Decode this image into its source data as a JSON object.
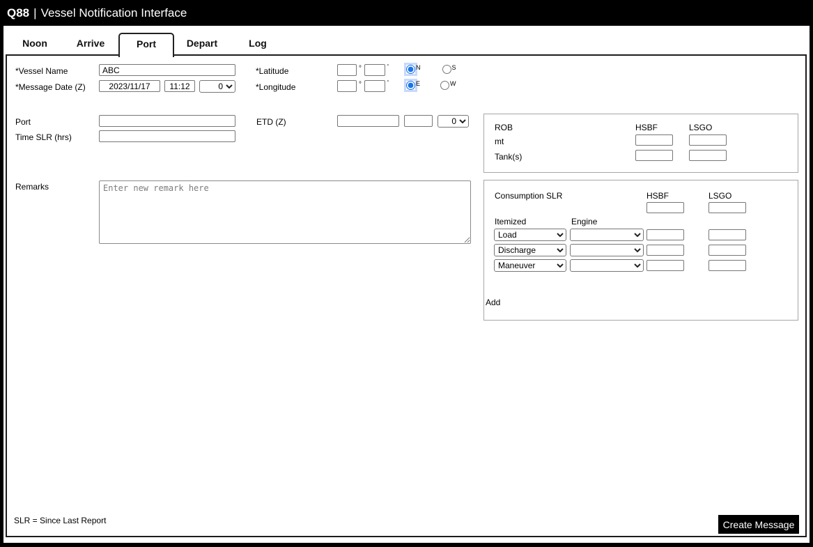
{
  "titlebar": {
    "brand": "Q88",
    "separator": "|",
    "title": "Vessel Notification Interface"
  },
  "tabs": [
    {
      "label": "Noon",
      "active": false
    },
    {
      "label": "Arrive",
      "active": false
    },
    {
      "label": "Port",
      "active": true
    },
    {
      "label": "Depart",
      "active": false
    },
    {
      "label": "Log",
      "active": false
    }
  ],
  "form": {
    "vessel_name": {
      "label": "*Vessel Name",
      "value": "ABC"
    },
    "message_date": {
      "label": "*Message Date (Z)",
      "date": "2023/11/17",
      "time": "11:12",
      "utc_offset": "0"
    },
    "latitude": {
      "label": "*Latitude",
      "degrees": "",
      "minutes": "",
      "deg_symbol": "°",
      "min_symbol": "'",
      "north_label": "N",
      "south_label": "S",
      "selected": "N"
    },
    "longitude": {
      "label": "*Longitude",
      "degrees": "",
      "minutes": "",
      "deg_symbol": "°",
      "min_symbol": "'",
      "east_label": "E",
      "west_label": "W",
      "selected": "E"
    },
    "port": {
      "label": "Port",
      "value": ""
    },
    "etd": {
      "label": "ETD (Z)",
      "date": "",
      "time": "",
      "utc_offset": "0"
    },
    "time_slr": {
      "label": "Time SLR (hrs)",
      "value": ""
    },
    "remarks": {
      "label": "Remarks",
      "placeholder": "Enter new remark here",
      "value": ""
    }
  },
  "rob": {
    "title": "ROB",
    "columns": [
      "HSBF",
      "LSGO"
    ],
    "rows": [
      {
        "label": "mt"
      },
      {
        "label": "Tank(s)"
      }
    ]
  },
  "consumption": {
    "title": "Consumption SLR",
    "columns": [
      "HSBF",
      "LSGO"
    ],
    "itemized_label": "Itemized",
    "engine_label": "Engine",
    "rows": [
      {
        "itemized": "Load"
      },
      {
        "itemized": "Discharge"
      },
      {
        "itemized": "Maneuver"
      }
    ],
    "add_label": "Add"
  },
  "footer": {
    "note": "SLR = Since Last Report",
    "create_button_label": "Create Message"
  },
  "colors": {
    "titlebar_bg": "#000000",
    "accent_radio": "#1a73e8",
    "button_bg": "#000000",
    "panel_border": "#1c1c1c"
  }
}
